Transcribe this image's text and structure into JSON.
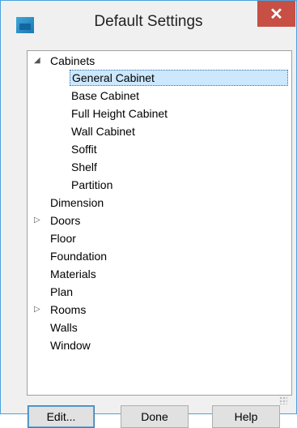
{
  "window": {
    "title": "Default Settings",
    "close_glyph": "✕"
  },
  "tree": {
    "items": [
      {
        "label": "Cabinets",
        "expander": "◢"
      },
      {
        "label": "General Cabinet"
      },
      {
        "label": "Base Cabinet"
      },
      {
        "label": "Full Height Cabinet"
      },
      {
        "label": "Wall Cabinet"
      },
      {
        "label": "Soffit"
      },
      {
        "label": "Shelf"
      },
      {
        "label": "Partition"
      },
      {
        "label": "Dimension"
      },
      {
        "label": "Doors",
        "expander": "▷"
      },
      {
        "label": "Floor"
      },
      {
        "label": "Foundation"
      },
      {
        "label": "Materials"
      },
      {
        "label": "Plan"
      },
      {
        "label": "Rooms",
        "expander": "▷"
      },
      {
        "label": "Walls"
      },
      {
        "label": "Window"
      }
    ],
    "selected": "General Cabinet"
  },
  "buttons": {
    "edit": "Edit...",
    "done": "Done",
    "help": "Help"
  }
}
